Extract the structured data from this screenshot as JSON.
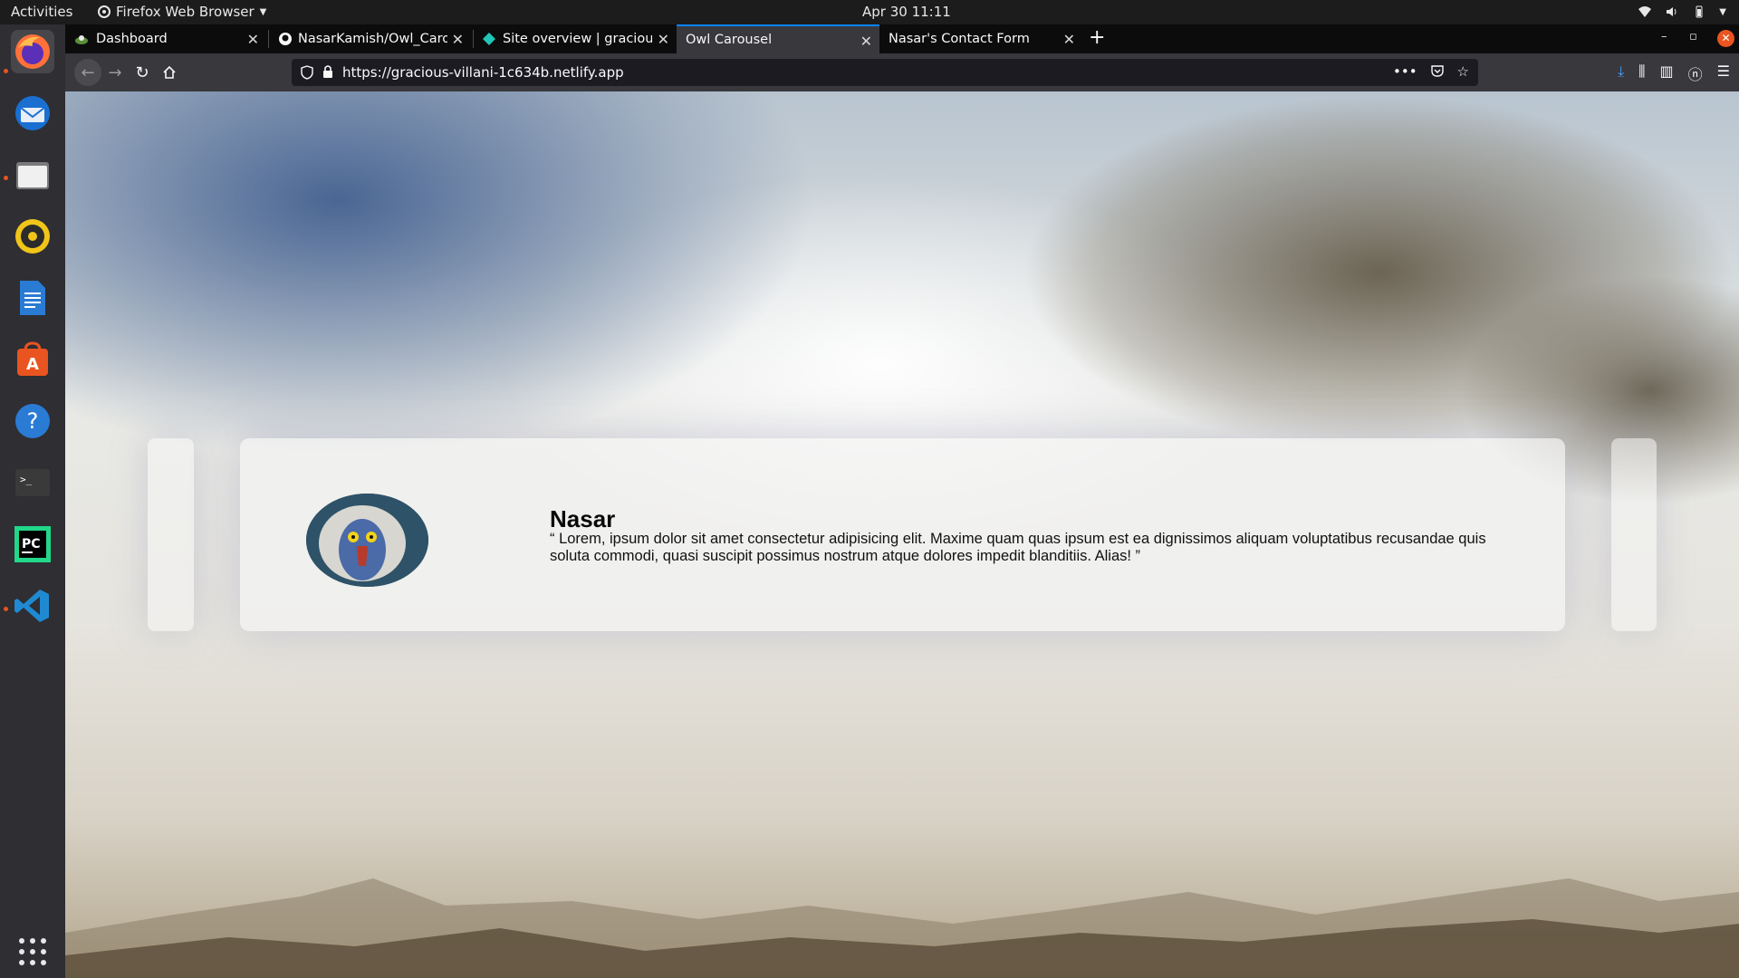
{
  "topbar": {
    "activities": "Activities",
    "app_name": "Firefox Web Browser",
    "clock": "Apr 30  11:11"
  },
  "dock": {
    "items": [
      {
        "name": "Firefox",
        "icon": "firefox-icon",
        "running": true
      },
      {
        "name": "Thunderbird",
        "icon": "thunderbird-icon",
        "running": false
      },
      {
        "name": "Files",
        "icon": "files-icon",
        "running": true
      },
      {
        "name": "Rhythmbox",
        "icon": "rhythmbox-icon",
        "running": false
      },
      {
        "name": "LibreOffice Writer",
        "icon": "writer-icon",
        "running": false
      },
      {
        "name": "Ubuntu Software",
        "icon": "software-icon",
        "running": false
      },
      {
        "name": "Help",
        "icon": "help-icon",
        "running": false
      },
      {
        "name": "Terminal",
        "icon": "terminal-icon",
        "running": false
      },
      {
        "name": "PyCharm",
        "icon": "pycharm-icon",
        "running": false
      },
      {
        "name": "VS Code",
        "icon": "vscode-icon",
        "running": true
      },
      {
        "name": "Show Applications",
        "icon": "app-grid-icon",
        "running": false
      }
    ]
  },
  "tabs": [
    {
      "title": "Dashboard",
      "icon": "dashboard-favicon-icon",
      "active": false
    },
    {
      "title": "NasarKamish/Owl_Carou",
      "icon": "github-icon",
      "active": false
    },
    {
      "title": "Site overview | gracious-v",
      "icon": "netlify-icon",
      "active": false
    },
    {
      "title": "Owl Carousel",
      "icon": "",
      "active": true
    },
    {
      "title": "Nasar's Contact Form",
      "icon": "",
      "active": false
    }
  ],
  "new_tab_label": "+",
  "url": "https://gracious-villani-1c634b.netlify.app",
  "carousel": {
    "name": "Nasar",
    "quote": "“ Lorem, ipsum dolor sit amet consectetur adipisicing elit. Maxime quam quas ipsum est ea dignissimos aliquam voluptatibus recusandae quis soluta commodi, quasi suscipit possimus nostrum atque dolores impedit blanditiis. Alias! ”"
  },
  "colors": {
    "accent": "#0a84ff",
    "ubuntu_orange": "#e95420"
  }
}
